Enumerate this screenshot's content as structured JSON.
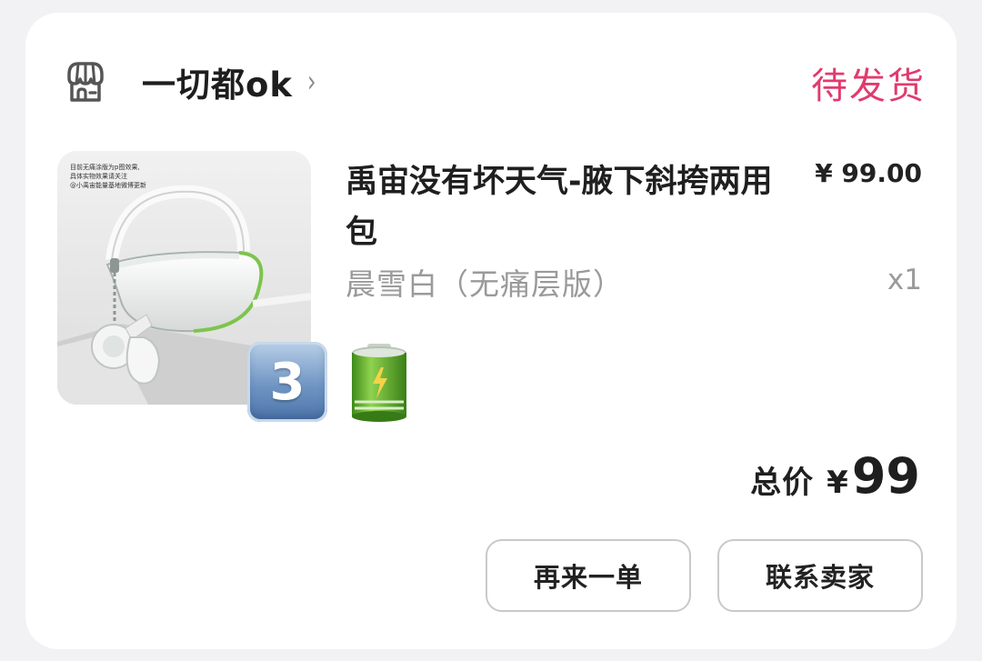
{
  "store": {
    "icon": "store-awning-icon",
    "name": "一切都ok",
    "chevron": "›"
  },
  "order": {
    "status": "待发货",
    "status_color": "#e23a6e"
  },
  "product": {
    "title": "禹宙没有坏天气-腋下斜挎两用包",
    "price": "¥ 99.00",
    "variant": "晨雪白（无痛层版）",
    "quantity": "x1",
    "image_caption": "目前无痛涂版为p图效果，具体实物效果请关注@小禹宙能量基地微博更新",
    "tags": [
      {
        "type": "emoji",
        "name": "keycap-three-icon",
        "text": "3"
      },
      {
        "type": "emoji",
        "name": "battery-icon"
      }
    ]
  },
  "summary": {
    "total_label": "总价",
    "currency": "¥",
    "total": "99"
  },
  "actions": {
    "reorder_label": "再来一单",
    "contact_label": "联系卖家"
  }
}
